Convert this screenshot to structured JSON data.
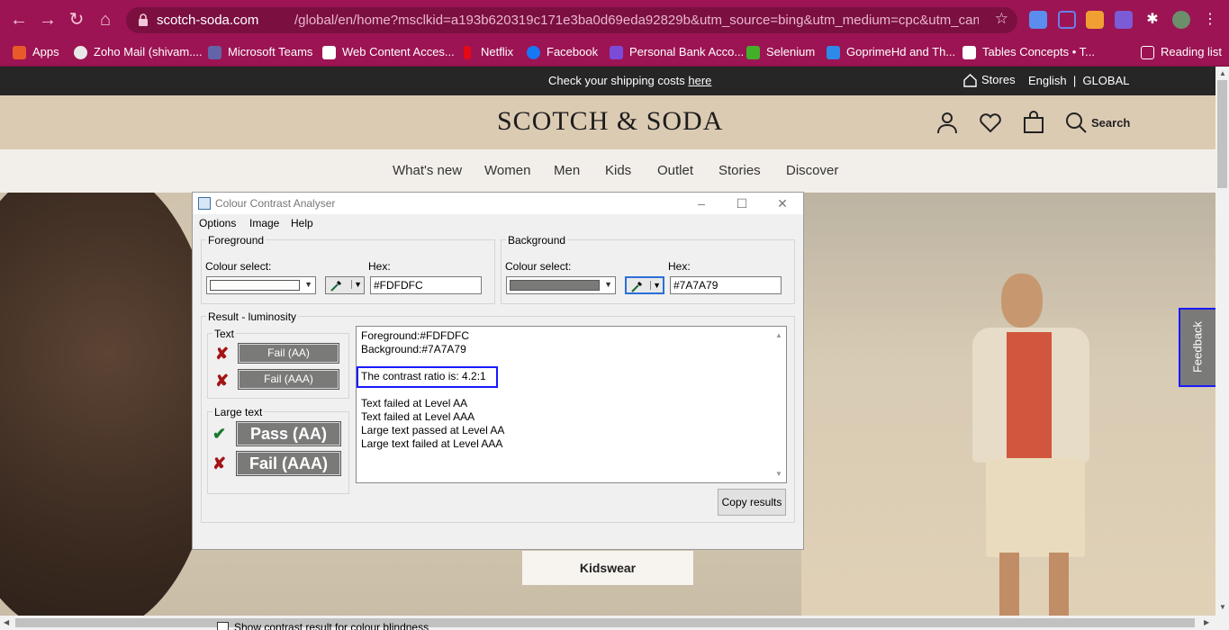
{
  "browser": {
    "url_host": "scotch-soda.com",
    "url_rest": "/global/en/home?msclkid=a193b620319c171e3ba0d69eda92829b&utm_source=bing&utm_medium=cpc&utm_campaign=SS-R...",
    "bookmarks": [
      {
        "label": "Apps"
      },
      {
        "label": "Zoho Mail (shivam...."
      },
      {
        "label": "Microsoft Teams"
      },
      {
        "label": "Web Content Acces..."
      },
      {
        "label": "Netflix"
      },
      {
        "label": "Facebook"
      },
      {
        "label": "Personal Bank Acco..."
      },
      {
        "label": "Selenium"
      },
      {
        "label": "GoprimeHd and Th..."
      },
      {
        "label": "Tables Concepts • T..."
      },
      {
        "label": "Reading list"
      }
    ],
    "colors": {
      "chrome": "#9c1453",
      "omnibox": "#7b0f40"
    }
  },
  "site": {
    "promo_text": "Check your shipping costs",
    "promo_link": "here",
    "stores_label": "Stores",
    "lang_label": "English  |  GLOBAL",
    "logo": "SCOTCH & SODA",
    "search_label": "Search",
    "nav": [
      "What's new",
      "Women",
      "Men",
      "Kids",
      "Outlet",
      "Stories",
      "Discover"
    ],
    "kidswear_label": "Kidswear",
    "feedback_label": "Feedback"
  },
  "cca": {
    "title": "Colour Contrast Analyser",
    "menu": [
      "Options",
      "Image",
      "Help"
    ],
    "foreground": {
      "group_label": "Foreground",
      "colour_select_label": "Colour select:",
      "hex_label": "Hex:",
      "hex_value": "#FDFDFC",
      "swatch_color": "#FDFDFC"
    },
    "background": {
      "group_label": "Background",
      "colour_select_label": "Colour select:",
      "hex_label": "Hex:",
      "hex_value": "#7A7A79",
      "swatch_color": "#7A7A79"
    },
    "result_label": "Result - luminosity",
    "text_group_label": "Text",
    "large_text_group_label": "Large text",
    "text_results": [
      {
        "label": "Fail (AA)",
        "status": "fail"
      },
      {
        "label": "Fail (AAA)",
        "status": "fail"
      }
    ],
    "large_text_results": [
      {
        "label": "Pass (AA)",
        "status": "pass"
      },
      {
        "label": "Fail (AAA)",
        "status": "fail"
      }
    ],
    "results_lines": [
      "Foreground:#FDFDFC",
      "Background:#7A7A79",
      "",
      "The contrast ratio is: 4.2:1",
      "",
      "Text failed at Level AA",
      "Text failed at Level AAA",
      "Large text passed at Level AA",
      "Large text failed at Level AAA"
    ],
    "colour_blindness_label": "Show contrast result for colour blindness",
    "colour_blindness_checked": false,
    "copy_results_label": "Copy results",
    "highlight_color": "#1a1aff"
  }
}
